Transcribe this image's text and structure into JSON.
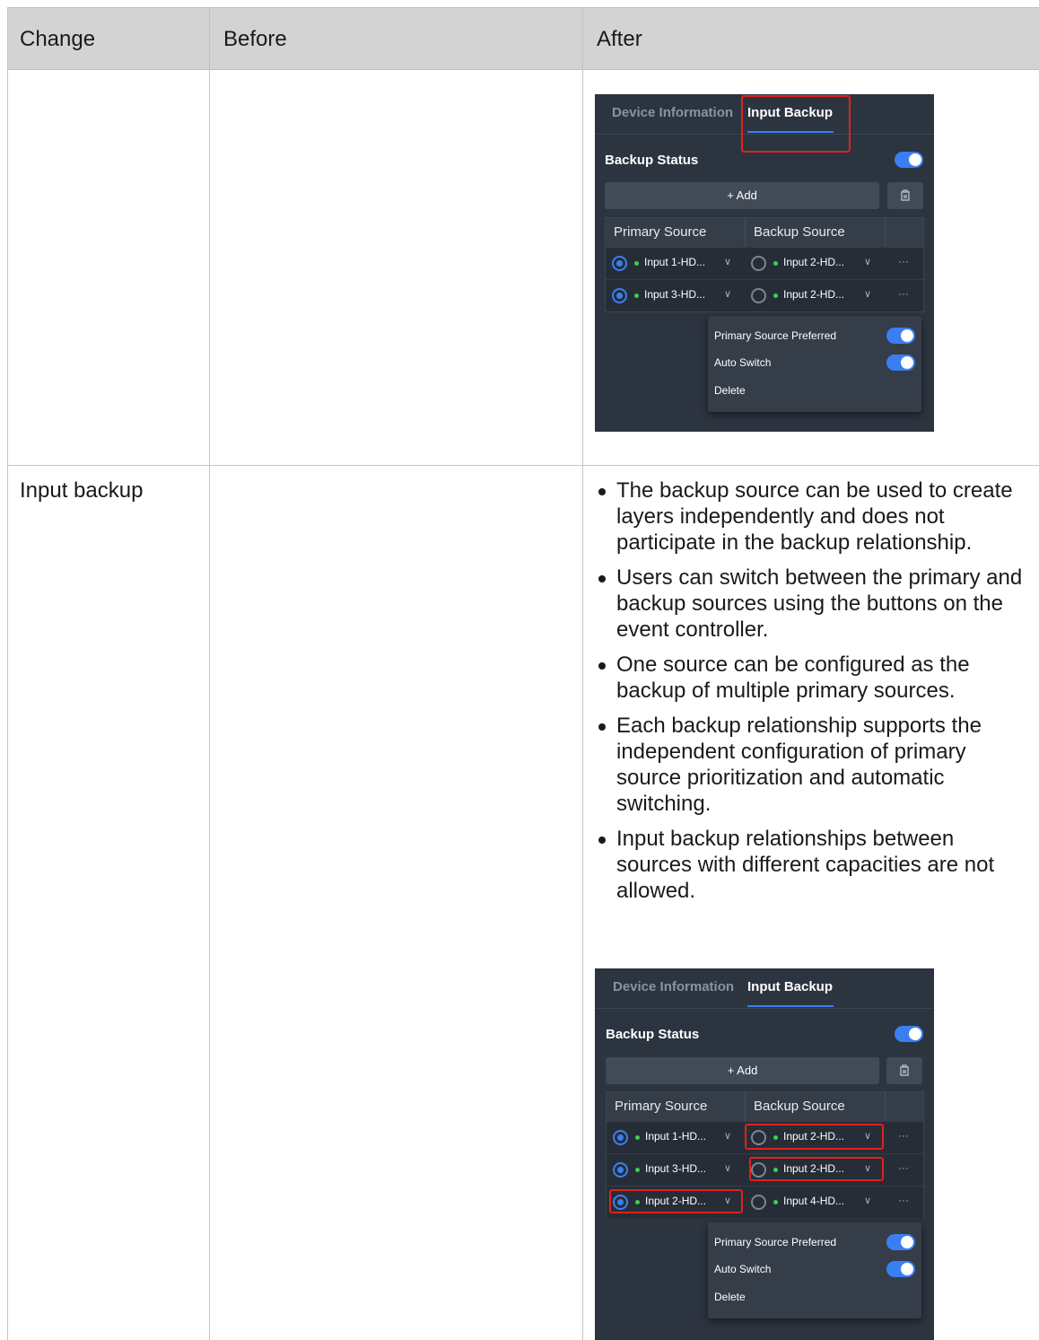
{
  "table": {
    "headers": [
      "Change",
      "Before",
      "After"
    ],
    "row2_change": "Input backup",
    "bullets": [
      "The backup source can be used to create layers independently and does not participate in the backup relationship.",
      "Users can switch between the primary and backup sources using the buttons on the event controller.",
      "One source can be configured as the backup of multiple primary sources.",
      "Each backup relationship supports the independent configuration of primary source prioritization and automatic switching.",
      "Input backup relationships between sources with different capacities are not allowed."
    ]
  },
  "screenshot1": {
    "tab_device": "Device Information",
    "tab_backup": "Input Backup",
    "backup_status": "Backup Status",
    "backup_status_on": true,
    "add_label": "+ Add",
    "col_primary": "Primary Source",
    "col_backup": "Backup Source",
    "rows": [
      {
        "primary": "Input 1-HD...",
        "backup": "Input 2-HD..."
      },
      {
        "primary": "Input 3-HD...",
        "backup": "Input 2-HD..."
      }
    ],
    "menu": {
      "primary_preferred": "Primary Source Preferred",
      "auto_switch": "Auto Switch",
      "delete": "Delete"
    }
  },
  "screenshot2": {
    "tab_device": "Device Information",
    "tab_backup": "Input Backup",
    "backup_status": "Backup Status",
    "add_label": "+ Add",
    "col_primary": "Primary Source",
    "col_backup": "Backup Source",
    "rows": [
      {
        "primary": "Input 1-HD...",
        "backup": "Input 2-HD..."
      },
      {
        "primary": "Input 3-HD...",
        "backup": "Input 2-HD..."
      },
      {
        "primary": "Input 2-HD...",
        "backup": "Input 4-HD..."
      }
    ],
    "menu": {
      "primary_preferred": "Primary Source Preferred",
      "auto_switch": "Auto Switch",
      "delete": "Delete"
    }
  },
  "colors": {
    "accent": "#3a7ff2",
    "highlight": "#e0211d",
    "panel": "#2c3440",
    "status_dot": "#3ccf4e"
  }
}
